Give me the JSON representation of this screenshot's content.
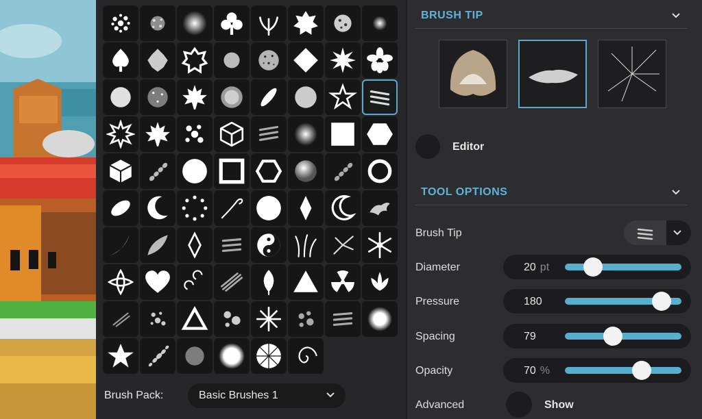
{
  "brushes": {
    "pack_label": "Brush Pack:",
    "pack_value": "Basic Brushes 1"
  },
  "brush_tip": {
    "title": "BRUSH TIP",
    "editor_label": "Editor"
  },
  "tool_options": {
    "title": "TOOL OPTIONS",
    "brush_tip_label": "Brush Tip",
    "diameter": {
      "label": "Diameter",
      "value": "20",
      "unit": "pt",
      "fraction": 0.24
    },
    "pressure": {
      "label": "Pressure",
      "value": "180",
      "unit": "",
      "fraction": 0.83
    },
    "spacing": {
      "label": "Spacing",
      "value": "79",
      "unit": "",
      "fraction": 0.41
    },
    "opacity": {
      "label": "Opacity",
      "value": "70",
      "unit": "%",
      "fraction": 0.66
    },
    "advanced_label": "Advanced",
    "advanced_show": "Show"
  },
  "colors": {
    "accent": "#5fb3d9",
    "slider": "#58aecf"
  }
}
